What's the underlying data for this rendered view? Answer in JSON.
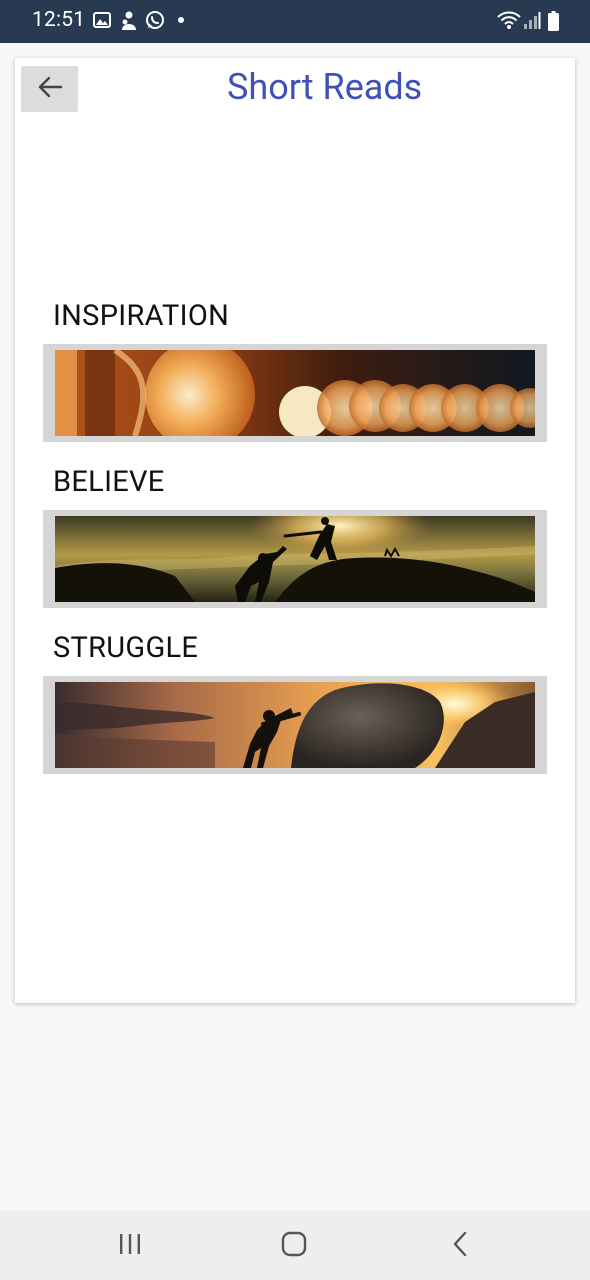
{
  "status_bar": {
    "time": "12:51",
    "icons": [
      "gallery-icon",
      "profile-icon",
      "whatsapp-icon",
      "notification-dot",
      "wifi-icon",
      "signal-icon",
      "battery-icon"
    ]
  },
  "header": {
    "title": "Short Reads",
    "back_icon": "arrow-left-icon"
  },
  "sections": [
    {
      "label": "INSPIRATION",
      "image": "glowing bokeh lights banner"
    },
    {
      "label": "BELIEVE",
      "image": "person helping another climb at sunset banner"
    },
    {
      "label": "STRUGGLE",
      "image": "person pushing a boulder uphill at sunset banner"
    }
  ],
  "nav_bar": {
    "icons": [
      "recents-icon",
      "home-icon",
      "back-icon"
    ]
  },
  "colors": {
    "status_bar_bg": "#273a52",
    "title": "#3f51b5",
    "back_button_bg": "#dcdcdc",
    "banner_frame": "#d5d5d5",
    "page_bg": "#f7f7f7",
    "nav_bar_bg": "#eeeeee"
  }
}
